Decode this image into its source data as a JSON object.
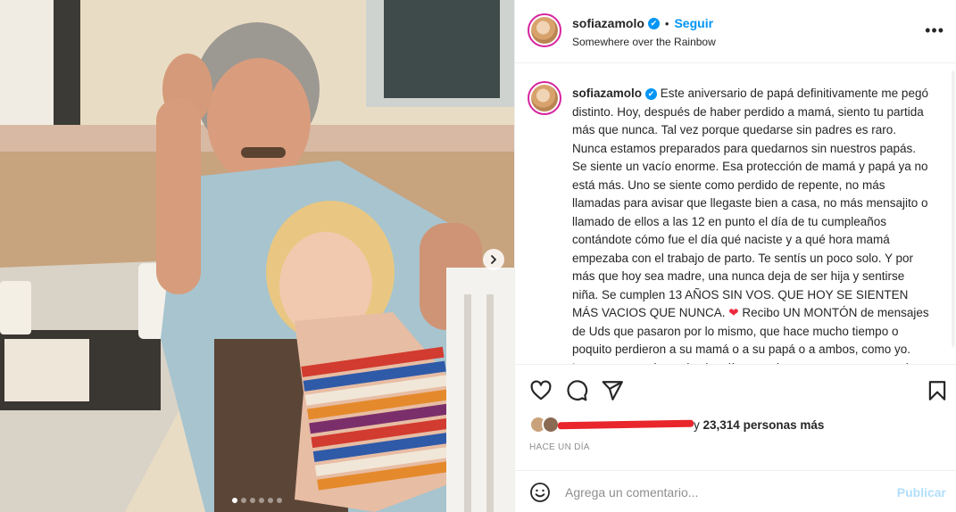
{
  "post": {
    "username": "sofiazamolo",
    "verified_glyph": "✔",
    "separator": "•",
    "follow_label": "Seguir",
    "location": "Somewhere over the Rainbow",
    "more_glyph": "•••"
  },
  "caption": {
    "username": "sofiazamolo",
    "text_part1": "Este aniversario de papá definitivamente me pegó distinto. Hoy, después de haber perdido a mamá, siento tu partida más que nunca. Tal vez porque quedarse sin padres es raro. Nunca estamos preparados para quedarnos sin nuestros papás. Se siente un vacío enorme. Esa protección de mamá y papá ya no está más. Uno se siente como perdido de repente, no más llamadas para avisar que llegaste bien a casa, no más mensajito o llamado de ellos a las 12 en punto el día de tu cumpleaños contándote cómo fue el día qué naciste y a qué hora mamá empezaba con el trabajo de parto. Te sentís un poco solo. Y por más que hoy sea madre, una nunca deja de ser hija y sentirse niña. Se cumplen 13 AÑOS SIN VOS. QUE HOY SE SIENTEN MÁS VACIOS QUE NUNCA. ",
    "heart": "❤",
    "text_part2": " Recibo UN MONTÓN de mensajes de Uds que pasaron por lo mismo, que hace mucho tiempo o poquito perdieron a su mamá o a su papá o a ambos, como yo. Leo sus mensajes todos los días, y quiero que sepan que sentirse acompañado, comprendido, saber que no estamos solos, ayuda a entender que es parte de la vida misma,"
  },
  "likes": {
    "prefix": "y",
    "count": "23,314",
    "suffix": "personas más"
  },
  "timestamp": "HACE UN DÍA",
  "comment": {
    "placeholder": "Agrega un comentario...",
    "publish_label": "Publicar"
  },
  "carousel": {
    "total_slides": 6,
    "active_slide": 1
  },
  "icons": [
    "chevron-right-icon",
    "heart-icon",
    "comment-icon",
    "share-icon",
    "bookmark-icon",
    "emoji-icon",
    "more-icon",
    "verified-icon"
  ],
  "colors": {
    "accent": "#0095f6",
    "text": "#262626",
    "muted": "#8e8e8e",
    "publish_disabled": "#b2dffc",
    "heart": "#ed2a3d",
    "redaction": "#e8262b"
  }
}
